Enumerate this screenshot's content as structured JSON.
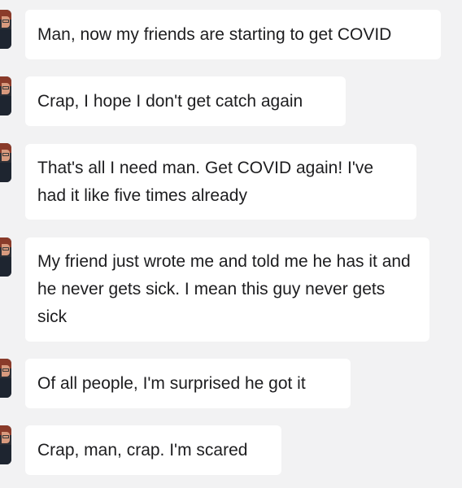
{
  "conversation": {
    "messages": [
      {
        "text": "Man, now my friends are starting to get COVID"
      },
      {
        "text": "Crap, I hope I don't get catch again"
      },
      {
        "text": "That's all I need man. Get COVID again! I've had it like five times already"
      },
      {
        "text": "My friend just wrote me and told me he has it and he never gets sick. I mean this guy never gets sick"
      },
      {
        "text": "Of all people, I'm surprised he got it"
      },
      {
        "text": "Crap, man, crap. I'm scared"
      }
    ]
  }
}
